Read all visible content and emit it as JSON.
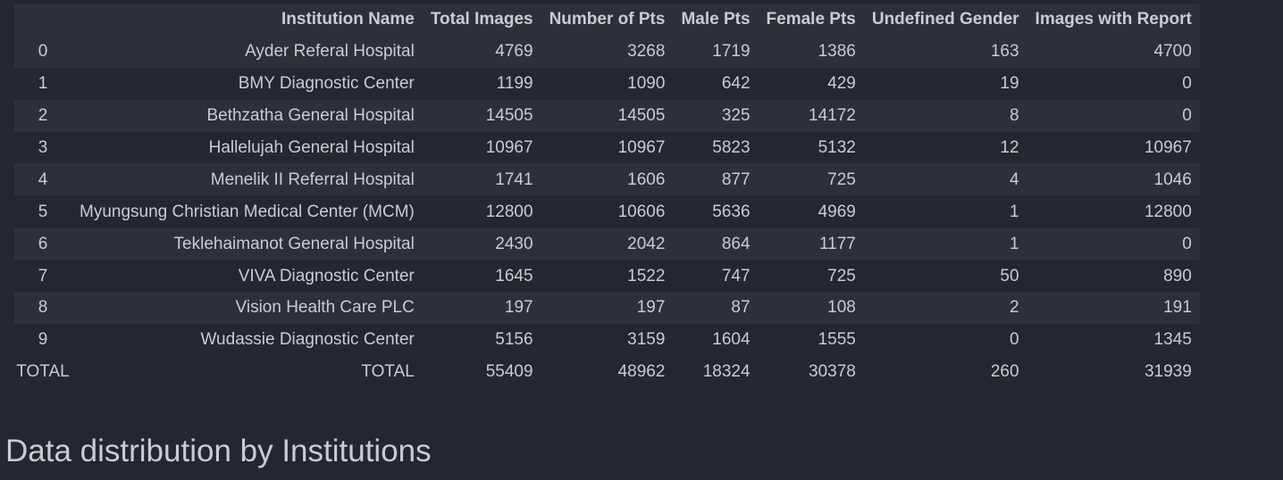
{
  "table": {
    "columns": [
      "",
      "Institution Name",
      "Total Images",
      "Number of Pts",
      "Male Pts",
      "Female Pts",
      "Undefined Gender",
      "Images with Report"
    ],
    "rows": [
      [
        "0",
        "Ayder Referal Hospital",
        "4769",
        "3268",
        "1719",
        "1386",
        "163",
        "4700"
      ],
      [
        "1",
        "BMY Diagnostic Center",
        "1199",
        "1090",
        "642",
        "429",
        "19",
        "0"
      ],
      [
        "2",
        "Bethzatha General Hospital",
        "14505",
        "14505",
        "325",
        "14172",
        "8",
        "0"
      ],
      [
        "3",
        "Hallelujah General Hospital",
        "10967",
        "10967",
        "5823",
        "5132",
        "12",
        "10967"
      ],
      [
        "4",
        "Menelik II Referral Hospital",
        "1741",
        "1606",
        "877",
        "725",
        "4",
        "1046"
      ],
      [
        "5",
        "Myungsung Christian Medical Center (MCM)",
        "12800",
        "10606",
        "5636",
        "4969",
        "1",
        "12800"
      ],
      [
        "6",
        "Teklehaimanot General Hospital",
        "2430",
        "2042",
        "864",
        "1177",
        "1",
        "0"
      ],
      [
        "7",
        "VIVA Diagnostic Center",
        "1645",
        "1522",
        "747",
        "725",
        "50",
        "890"
      ],
      [
        "8",
        "Vision Health Care PLC",
        "197",
        "197",
        "87",
        "108",
        "2",
        "191"
      ],
      [
        "9",
        "Wudassie Diagnostic Center",
        "5156",
        "3159",
        "1604",
        "1555",
        "0",
        "1345"
      ],
      [
        "TOTAL",
        "TOTAL",
        "55409",
        "48962",
        "18324",
        "30378",
        "260",
        "31939"
      ]
    ]
  },
  "section_heading": "Data distribution by Institutions"
}
